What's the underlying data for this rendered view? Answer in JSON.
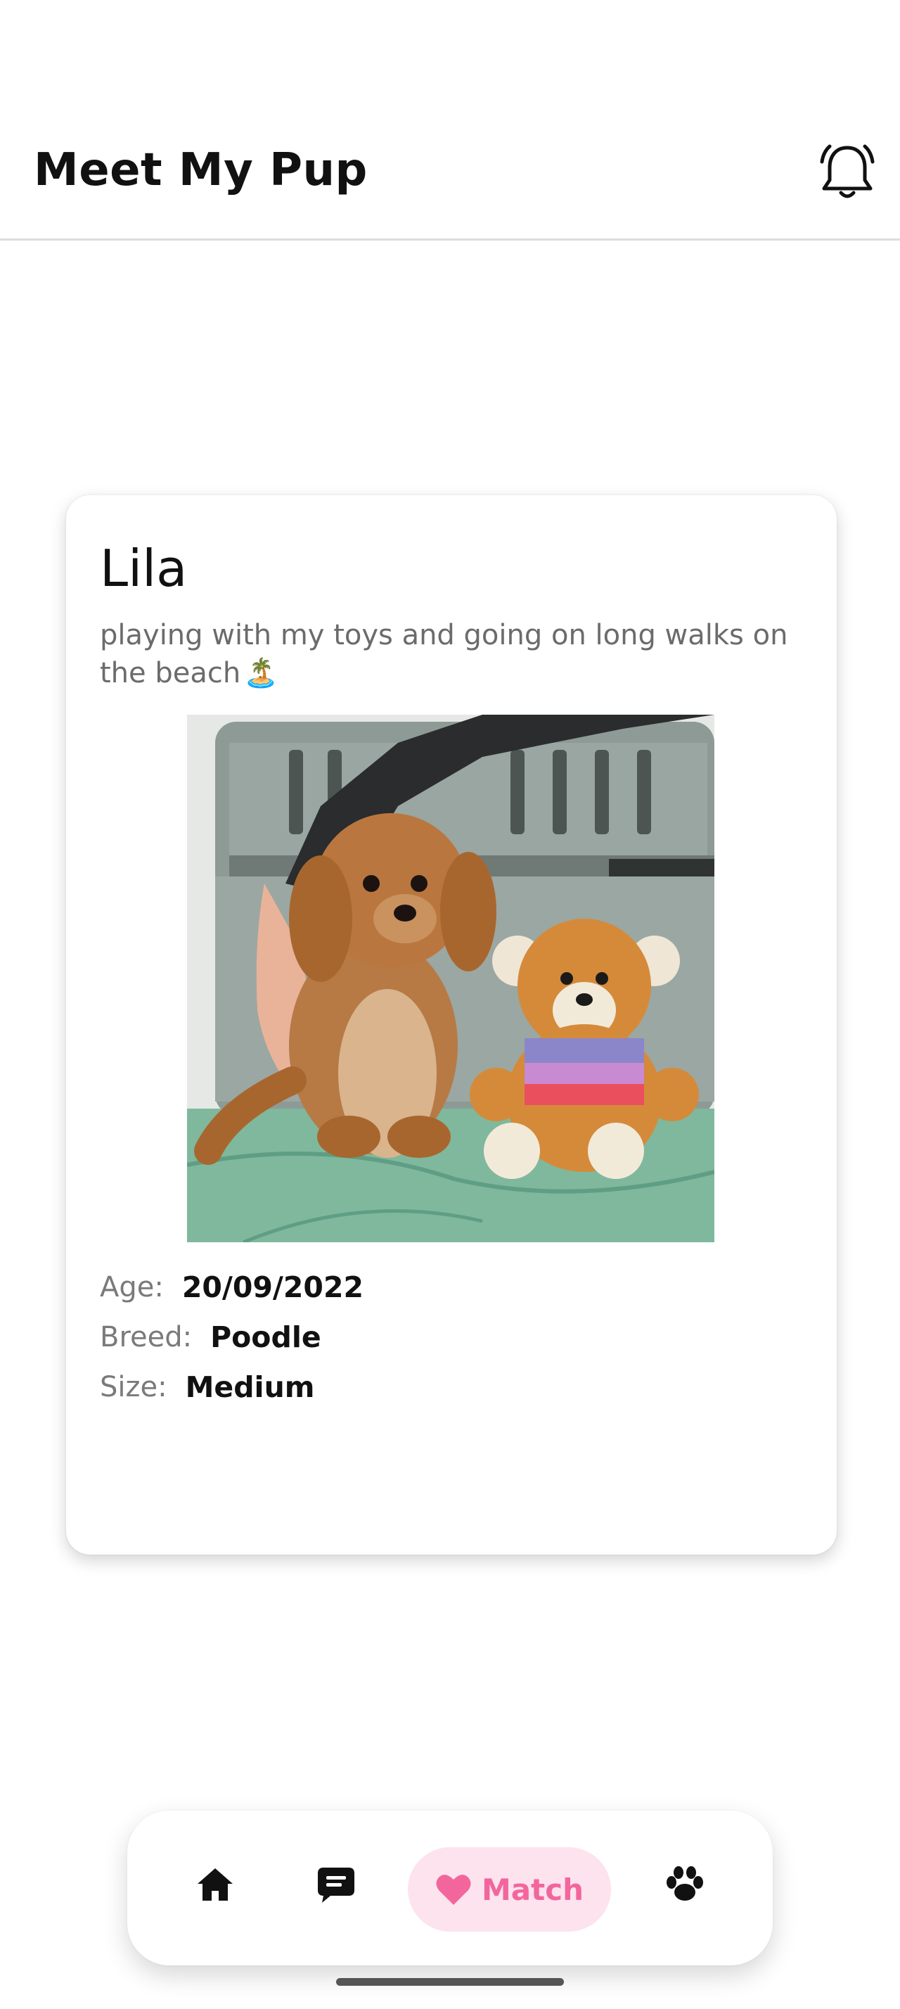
{
  "header": {
    "title": "Meet My Pup",
    "notification_icon": "bell-icon"
  },
  "profile": {
    "name": "Lila",
    "bio": "playing with my toys and going on long walks on the beach",
    "bio_emoji": "🏝️",
    "photo_description_icon": "dog-photo",
    "age_label": "Age:",
    "age_value": "20/09/2022",
    "breed_label": "Breed:",
    "breed_value": "Poodle",
    "size_label": "Size:",
    "size_value": "Medium"
  },
  "nav": {
    "items": [
      {
        "icon": "home-icon"
      },
      {
        "icon": "chat-icon"
      },
      {
        "icon": "heart-icon",
        "label": "Match",
        "active": true
      },
      {
        "icon": "paw-icon"
      }
    ],
    "active_color": "#f2669d",
    "active_bg": "#fde3ee"
  }
}
